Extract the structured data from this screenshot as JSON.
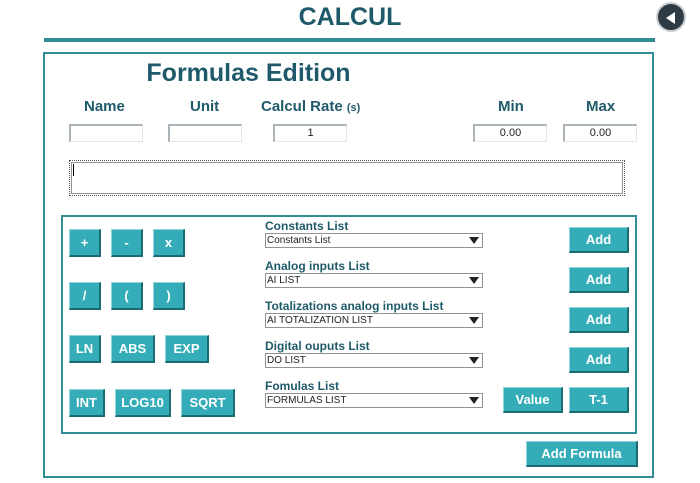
{
  "header": {
    "title": "CALCUL",
    "back_icon": "back-arrow-icon"
  },
  "editor": {
    "title": "Formulas Edition",
    "fields": {
      "name": {
        "label": "Name",
        "value": ""
      },
      "unit": {
        "label": "Unit",
        "value": ""
      },
      "rate": {
        "label": "Calcul Rate",
        "unit": "(s)",
        "value": "1"
      },
      "min": {
        "label": "Min",
        "value": "0.00"
      },
      "max": {
        "label": "Max",
        "value": "0.00"
      }
    },
    "formula_value": ""
  },
  "operators": [
    "+",
    "-",
    "x",
    "/",
    "(",
    ")",
    "LN",
    "ABS",
    "EXP",
    "INT",
    "LOG10",
    "SQRT"
  ],
  "lists": [
    {
      "label": "Constants List",
      "selected": "Constants List",
      "action": "Add"
    },
    {
      "label": "Analog inputs List",
      "selected": "AI LIST",
      "action": "Add"
    },
    {
      "label": "Totalizations analog inputs List",
      "selected": "AI TOTALIZATION LIST",
      "action": "Add"
    },
    {
      "label": "Digital ouputs List",
      "selected": "DO LIST",
      "action": "Add"
    },
    {
      "label": "Fomulas List",
      "selected": "FORMULAS LIST",
      "action": "Value",
      "action2": "T-1"
    }
  ],
  "footer": {
    "add_formula": "Add Formula"
  },
  "colors": {
    "teal": "#34adb8",
    "dark_teal": "#1f5a6b",
    "border": "#2f8d95"
  }
}
